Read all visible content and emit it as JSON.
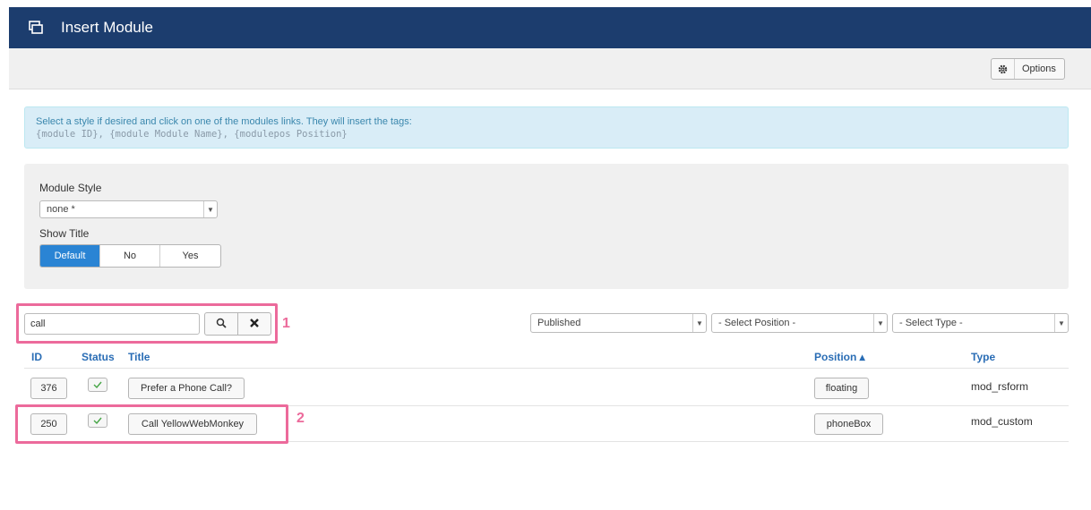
{
  "titlebar": {
    "title": "Insert Module",
    "icon": "module-icon"
  },
  "toolbar": {
    "options_label": "Options",
    "options_icon": "gear-icon"
  },
  "info": {
    "line1": "Select a style if desired and click on one of the modules links. They will insert the tags:",
    "tag1": "{module ID}",
    "tag2": "{module Module Name}",
    "tag3": "{modulepos Position}"
  },
  "style_form": {
    "module_style_label": "Module Style",
    "module_style_value": "none *",
    "show_title_label": "Show Title",
    "show_title_options": [
      "Default",
      "No",
      "Yes"
    ],
    "show_title_selected": "Default"
  },
  "filters": {
    "search_value": "call",
    "status_value": "Published",
    "position_value": "- Select Position -",
    "type_value": "- Select Type -"
  },
  "table": {
    "headers": {
      "id": "ID",
      "status": "Status",
      "title": "Title",
      "position": "Position ▴",
      "type": "Type"
    },
    "rows": [
      {
        "id": "376",
        "title": "Prefer a Phone Call?",
        "position": "floating",
        "type": "mod_rsform"
      },
      {
        "id": "250",
        "title": "Call YellowWebMonkey",
        "position": "phoneBox",
        "type": "mod_custom"
      }
    ]
  },
  "annotations": {
    "n1": "1",
    "n2": "2"
  },
  "colors": {
    "header_bg": "#1c3d6e",
    "link": "#2a6db5",
    "active": "#2a84d4",
    "highlight": "#ec6a9b",
    "info_bg": "#d9edf7"
  }
}
